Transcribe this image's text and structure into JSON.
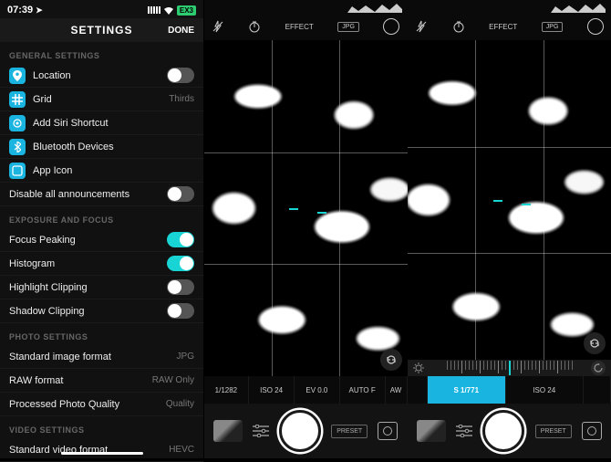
{
  "settings": {
    "status": {
      "time": "07:39",
      "battery": "EX3"
    },
    "nav": {
      "title": "SETTINGS",
      "done": "DONE"
    },
    "sections": {
      "general": {
        "header": "GENERAL SETTINGS",
        "location": "Location",
        "grid": "Grid",
        "grid_val": "Thirds",
        "siri": "Add Siri Shortcut",
        "bluetooth": "Bluetooth Devices",
        "appicon": "App Icon",
        "disable": "Disable all announcements"
      },
      "exposure": {
        "header": "EXPOSURE AND FOCUS",
        "peak": "Focus Peaking",
        "histo": "Histogram",
        "highlight": "Highlight Clipping",
        "shadow": "Shadow Clipping"
      },
      "photo": {
        "header": "PHOTO SETTINGS",
        "std": "Standard image format",
        "std_val": "JPG",
        "raw": "RAW format",
        "raw_val": "RAW Only",
        "proc": "Processed Photo Quality",
        "proc_val": "Quality"
      },
      "video": {
        "header": "VIDEO SETTINGS",
        "std": "Standard video format",
        "std_val": "HEVC"
      }
    }
  },
  "camera": {
    "top": {
      "effect": "EFFECT",
      "format": "JPG"
    },
    "info_auto": {
      "shutter": "1/1282",
      "iso": "ISO 24",
      "ev": "EV 0.0",
      "focus": "AUTO F",
      "wb": "AW"
    },
    "info_manual": {
      "shutter": "S 1/771",
      "iso": "ISO 24",
      "ev": ""
    },
    "preset": "PRESET"
  }
}
